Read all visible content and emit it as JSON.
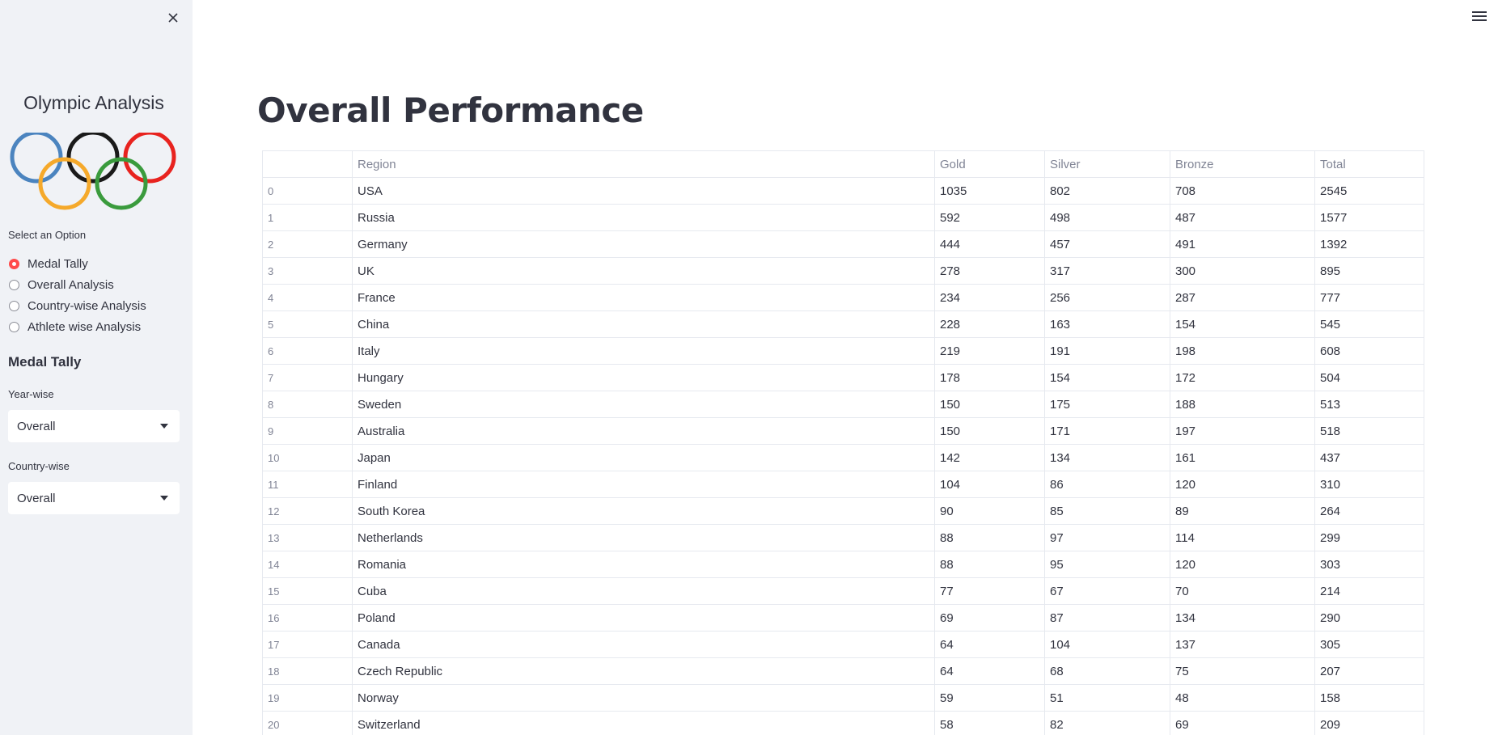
{
  "sidebar": {
    "title": "Olympic Analysis",
    "logo_icon": "olympic-rings",
    "select_label": "Select an Option",
    "options": [
      {
        "label": "Medal Tally",
        "selected": true
      },
      {
        "label": "Overall Analysis",
        "selected": false
      },
      {
        "label": "Country-wise Analysis",
        "selected": false
      },
      {
        "label": "Athlete wise Analysis",
        "selected": false
      }
    ],
    "section_heading": "Medal Tally",
    "year_label": "Year-wise",
    "year_value": "Overall",
    "country_label": "Country-wise",
    "country_value": "Overall"
  },
  "main": {
    "title": "Overall Performance",
    "table": {
      "columns": [
        "",
        "Region",
        "Gold",
        "Silver",
        "Bronze",
        "Total"
      ],
      "rows": [
        [
          "0",
          "USA",
          "1035",
          "802",
          "708",
          "2545"
        ],
        [
          "1",
          "Russia",
          "592",
          "498",
          "487",
          "1577"
        ],
        [
          "2",
          "Germany",
          "444",
          "457",
          "491",
          "1392"
        ],
        [
          "3",
          "UK",
          "278",
          "317",
          "300",
          "895"
        ],
        [
          "4",
          "France",
          "234",
          "256",
          "287",
          "777"
        ],
        [
          "5",
          "China",
          "228",
          "163",
          "154",
          "545"
        ],
        [
          "6",
          "Italy",
          "219",
          "191",
          "198",
          "608"
        ],
        [
          "7",
          "Hungary",
          "178",
          "154",
          "172",
          "504"
        ],
        [
          "8",
          "Sweden",
          "150",
          "175",
          "188",
          "513"
        ],
        [
          "9",
          "Australia",
          "150",
          "171",
          "197",
          "518"
        ],
        [
          "10",
          "Japan",
          "142",
          "134",
          "161",
          "437"
        ],
        [
          "11",
          "Finland",
          "104",
          "86",
          "120",
          "310"
        ],
        [
          "12",
          "South Korea",
          "90",
          "85",
          "89",
          "264"
        ],
        [
          "13",
          "Netherlands",
          "88",
          "97",
          "114",
          "299"
        ],
        [
          "14",
          "Romania",
          "88",
          "95",
          "120",
          "303"
        ],
        [
          "15",
          "Cuba",
          "77",
          "67",
          "70",
          "214"
        ],
        [
          "16",
          "Poland",
          "69",
          "87",
          "134",
          "290"
        ],
        [
          "17",
          "Canada",
          "64",
          "104",
          "137",
          "305"
        ],
        [
          "18",
          "Czech Republic",
          "64",
          "68",
          "75",
          "207"
        ],
        [
          "19",
          "Norway",
          "59",
          "51",
          "48",
          "158"
        ],
        [
          "20",
          "Switzerland",
          "58",
          "82",
          "69",
          "209"
        ]
      ]
    }
  },
  "colors": {
    "accent": "#ff4b4b",
    "sidebar_bg": "#f0f2f6",
    "text": "#31333f",
    "muted": "#808495",
    "ring_blue": "#4b84bf",
    "ring_yellow": "#f5a92b",
    "ring_black": "#1a1a1a",
    "ring_green": "#3a9b3d",
    "ring_red": "#e8231f"
  }
}
